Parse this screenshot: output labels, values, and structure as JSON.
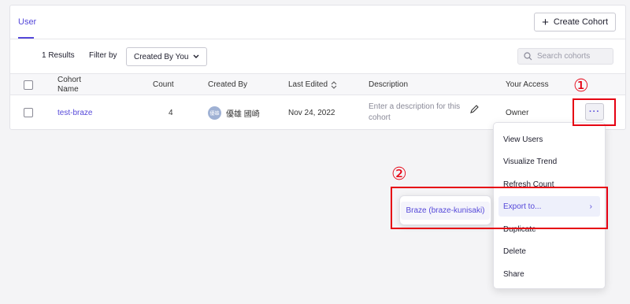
{
  "tabs": [
    {
      "label": "User",
      "active": true
    }
  ],
  "header": {
    "create_button": "Create Cohort"
  },
  "toolbar": {
    "results": "1 Results",
    "filter_label": "Filter by",
    "filter_value": "Created By You",
    "search_placeholder": "Search cohorts"
  },
  "table": {
    "columns": {
      "cohort_name": "Cohort\nName",
      "count": "Count",
      "created_by": "Created By",
      "last_edited": "Last Edited",
      "description": "Description",
      "your_access": "Your Access"
    },
    "rows": [
      {
        "name": "test-braze",
        "count": "4",
        "avatar_text": "優雄",
        "created_by": "優雄 國崎",
        "last_edited": "Nov 24, 2022",
        "description_placeholder": "Enter a description for this cohort",
        "access": "Owner"
      }
    ]
  },
  "more_button": "···",
  "menu": {
    "items": [
      "View Users",
      "Visualize Trend",
      "Refresh Count",
      "Export to...",
      "Duplicate",
      "Delete",
      "Share"
    ]
  },
  "submenu": {
    "item": "Braze (braze-kunisaki)"
  },
  "annotations": {
    "marker1": "①",
    "marker2": "②"
  },
  "colors": {
    "accent": "#5548d9",
    "highlight": "#e60012"
  }
}
